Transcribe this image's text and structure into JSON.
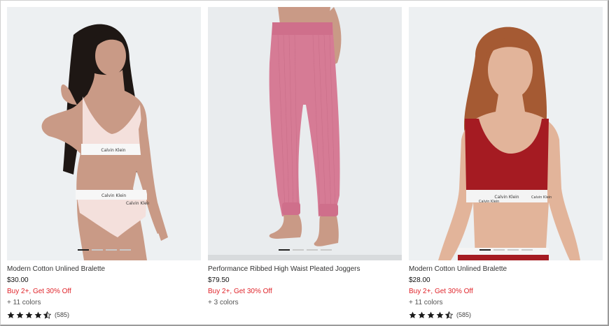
{
  "products": [
    {
      "name": "Modern Cotton Unlined Bralette",
      "price": "$30.00",
      "promo": "Buy 2+, Get 30% Off",
      "colors": "+ 11 colors",
      "rating": 4.5,
      "reviews": "(585)",
      "image": "model-white-bralette-set",
      "garment_color": "#f4e0dc",
      "band_text": "Calvin Klein",
      "carousel_dots": 4,
      "carousel_active": 0
    },
    {
      "name": "Performance Ribbed High Waist Pleated Joggers",
      "price": "$79.50",
      "promo": "Buy 2+, Get 30% Off",
      "colors": "+ 3 colors",
      "image": "pink-ribbed-joggers",
      "garment_color": "#d67b95",
      "carousel_dots": 4,
      "carousel_active": 0
    },
    {
      "name": "Modern Cotton Unlined Bralette",
      "price": "$28.00",
      "promo": "Buy 2+, Get 30% Off",
      "colors": "+ 11 colors",
      "rating": 4.5,
      "reviews": "(585)",
      "image": "model-red-bralette",
      "garment_color": "#a51b22",
      "band_text": "Calvin Klein",
      "carousel_dots": 4,
      "carousel_active": 0
    }
  ],
  "colors": {
    "promo": "#e0252b",
    "star": "#1a1a1a",
    "background": "#ffffff"
  }
}
